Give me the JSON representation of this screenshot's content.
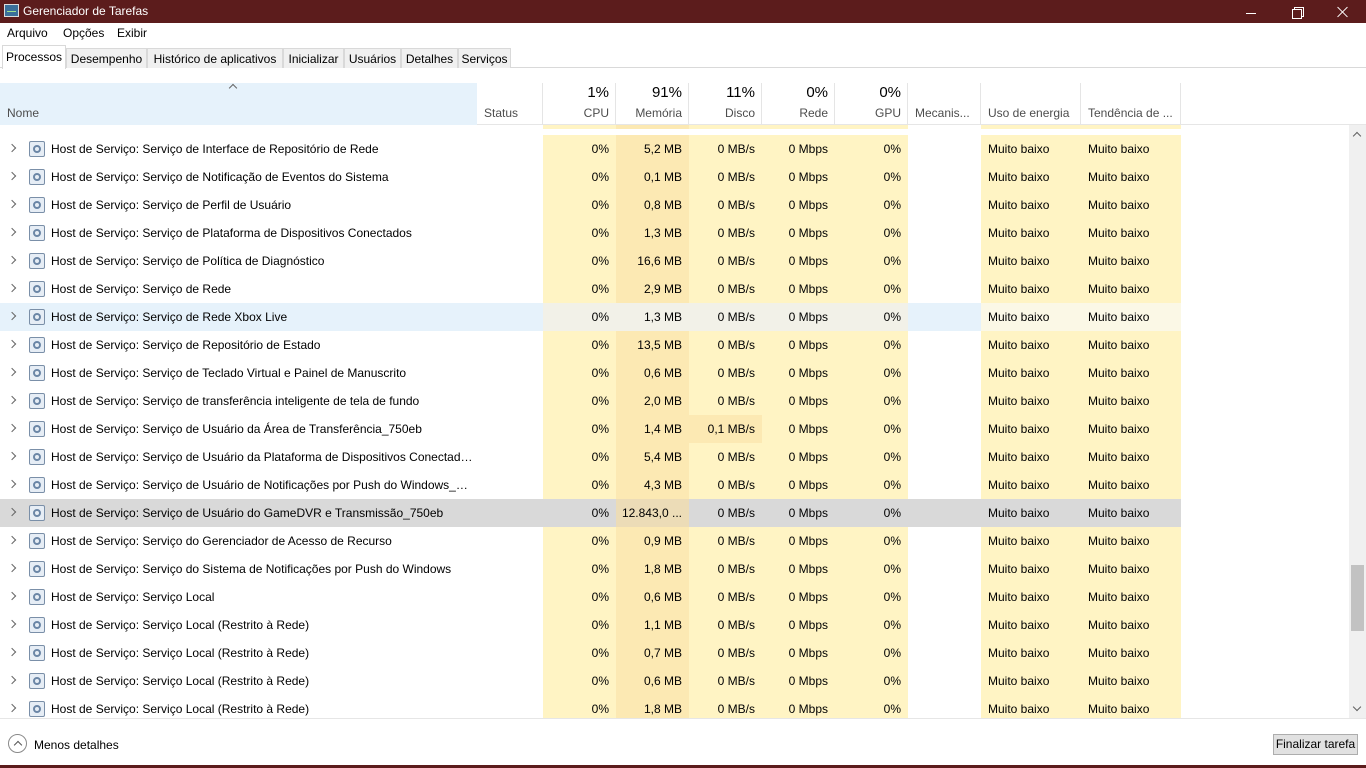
{
  "window": {
    "title": "Gerenciador de Tarefas",
    "icon": "task-manager-icon"
  },
  "menu": [
    "Arquivo",
    "Opções",
    "Exibir"
  ],
  "tabs": [
    "Processos",
    "Desempenho",
    "Histórico de aplicativos",
    "Inicializar",
    "Usuários",
    "Detalhes",
    "Serviços"
  ],
  "header": {
    "name": "Nome",
    "status": "Status",
    "cpu": {
      "pct": "1%",
      "label": "CPU"
    },
    "mem": {
      "pct": "91%",
      "label": "Memória"
    },
    "disk": {
      "pct": "11%",
      "label": "Disco"
    },
    "net": {
      "pct": "0%",
      "label": "Rede"
    },
    "gpu": {
      "pct": "0%",
      "label": "GPU"
    },
    "engine": "Mecanis...",
    "power": "Uso de energia",
    "trend": "Tendência de ..."
  },
  "rows": [
    {
      "name": "Host de Serviço: Serviço de Interface de Repositório de Rede",
      "cpu": "0%",
      "mem": "5,2 MB",
      "disk": "0 MB/s",
      "net": "0 Mbps",
      "gpu": "0%",
      "power": "Muito baixo",
      "trend": "Muito baixo"
    },
    {
      "name": "Host de Serviço: Serviço de Notificação de Eventos do Sistema",
      "cpu": "0%",
      "mem": "0,1 MB",
      "disk": "0 MB/s",
      "net": "0 Mbps",
      "gpu": "0%",
      "power": "Muito baixo",
      "trend": "Muito baixo"
    },
    {
      "name": "Host de Serviço: Serviço de Perfil de Usuário",
      "cpu": "0%",
      "mem": "0,8 MB",
      "disk": "0 MB/s",
      "net": "0 Mbps",
      "gpu": "0%",
      "power": "Muito baixo",
      "trend": "Muito baixo"
    },
    {
      "name": "Host de Serviço: Serviço de Plataforma de Dispositivos Conectados",
      "cpu": "0%",
      "mem": "1,3 MB",
      "disk": "0 MB/s",
      "net": "0 Mbps",
      "gpu": "0%",
      "power": "Muito baixo",
      "trend": "Muito baixo"
    },
    {
      "name": "Host de Serviço: Serviço de Política de Diagnóstico",
      "cpu": "0%",
      "mem": "16,6 MB",
      "disk": "0 MB/s",
      "net": "0 Mbps",
      "gpu": "0%",
      "power": "Muito baixo",
      "trend": "Muito baixo"
    },
    {
      "name": "Host de Serviço: Serviço de Rede",
      "cpu": "0%",
      "mem": "2,9 MB",
      "disk": "0 MB/s",
      "net": "0 Mbps",
      "gpu": "0%",
      "power": "Muito baixo",
      "trend": "Muito baixo"
    },
    {
      "name": "Host de Serviço: Serviço de Rede Xbox Live",
      "cpu": "0%",
      "mem": "1,3 MB",
      "disk": "0 MB/s",
      "net": "0 Mbps",
      "gpu": "0%",
      "power": "Muito baixo",
      "trend": "Muito baixo"
    },
    {
      "name": "Host de Serviço: Serviço de Repositório de Estado",
      "cpu": "0%",
      "mem": "13,5 MB",
      "disk": "0 MB/s",
      "net": "0 Mbps",
      "gpu": "0%",
      "power": "Muito baixo",
      "trend": "Muito baixo"
    },
    {
      "name": "Host de Serviço: Serviço de Teclado Virtual e Painel de Manuscrito",
      "cpu": "0%",
      "mem": "0,6 MB",
      "disk": "0 MB/s",
      "net": "0 Mbps",
      "gpu": "0%",
      "power": "Muito baixo",
      "trend": "Muito baixo"
    },
    {
      "name": "Host de Serviço: Serviço de transferência inteligente de tela de fundo",
      "cpu": "0%",
      "mem": "2,0 MB",
      "disk": "0 MB/s",
      "net": "0 Mbps",
      "gpu": "0%",
      "power": "Muito baixo",
      "trend": "Muito baixo"
    },
    {
      "name": "Host de Serviço: Serviço de Usuário da Área de Transferência_750eb",
      "cpu": "0%",
      "mem": "1,4 MB",
      "disk": "0,1 MB/s",
      "net": "0 Mbps",
      "gpu": "0%",
      "power": "Muito baixo",
      "trend": "Muito baixo"
    },
    {
      "name": "Host de Serviço: Serviço de Usuário da Plataforma de Dispositivos Conectados...",
      "cpu": "0%",
      "mem": "5,4 MB",
      "disk": "0 MB/s",
      "net": "0 Mbps",
      "gpu": "0%",
      "power": "Muito baixo",
      "trend": "Muito baixo"
    },
    {
      "name": "Host de Serviço: Serviço de Usuário de Notificações por Push do Windows_75...",
      "cpu": "0%",
      "mem": "4,3 MB",
      "disk": "0 MB/s",
      "net": "0 Mbps",
      "gpu": "0%",
      "power": "Muito baixo",
      "trend": "Muito baixo"
    },
    {
      "name": "Host de Serviço: Serviço de Usuário do GameDVR e Transmissão_750eb",
      "cpu": "0%",
      "mem": "12.843,0 ...",
      "disk": "0 MB/s",
      "net": "0 Mbps",
      "gpu": "0%",
      "power": "Muito baixo",
      "trend": "Muito baixo"
    },
    {
      "name": "Host de Serviço: Serviço do Gerenciador de Acesso de Recurso",
      "cpu": "0%",
      "mem": "0,9 MB",
      "disk": "0 MB/s",
      "net": "0 Mbps",
      "gpu": "0%",
      "power": "Muito baixo",
      "trend": "Muito baixo"
    },
    {
      "name": "Host de Serviço: Serviço do Sistema de Notificações por Push do Windows",
      "cpu": "0%",
      "mem": "1,8 MB",
      "disk": "0 MB/s",
      "net": "0 Mbps",
      "gpu": "0%",
      "power": "Muito baixo",
      "trend": "Muito baixo"
    },
    {
      "name": "Host de Serviço: Serviço Local",
      "cpu": "0%",
      "mem": "0,6 MB",
      "disk": "0 MB/s",
      "net": "0 Mbps",
      "gpu": "0%",
      "power": "Muito baixo",
      "trend": "Muito baixo"
    },
    {
      "name": "Host de Serviço: Serviço Local (Restrito à Rede)",
      "cpu": "0%",
      "mem": "1,1 MB",
      "disk": "0 MB/s",
      "net": "0 Mbps",
      "gpu": "0%",
      "power": "Muito baixo",
      "trend": "Muito baixo"
    },
    {
      "name": "Host de Serviço: Serviço Local (Restrito à Rede)",
      "cpu": "0%",
      "mem": "0,7 MB",
      "disk": "0 MB/s",
      "net": "0 Mbps",
      "gpu": "0%",
      "power": "Muito baixo",
      "trend": "Muito baixo"
    },
    {
      "name": "Host de Serviço: Serviço Local (Restrito à Rede)",
      "cpu": "0%",
      "mem": "0,6 MB",
      "disk": "0 MB/s",
      "net": "0 Mbps",
      "gpu": "0%",
      "power": "Muito baixo",
      "trend": "Muito baixo"
    },
    {
      "name": "Host de Serviço: Serviço Local (Restrito à Rede)",
      "cpu": "0%",
      "mem": "1,8 MB",
      "disk": "0 MB/s",
      "net": "0 Mbps",
      "gpu": "0%",
      "power": "Muito baixo",
      "trend": "Muito baixo"
    }
  ],
  "hover_row": "Host de Serviço: Serviço de Rede Xbox Live",
  "selected_row": "Host de Serviço: Serviço de Usuário do GameDVR e Transmissão_750eb",
  "footer": {
    "less_details": "Menos detalhes",
    "end_task": "Finalizar tarefa"
  },
  "colors": {
    "titlebar": "#5c1c1c",
    "usage_light": "#fff4c4",
    "usage_medium": "#fce9b3",
    "hover": "#e6f2fb",
    "selected": "#d9d9d9"
  }
}
